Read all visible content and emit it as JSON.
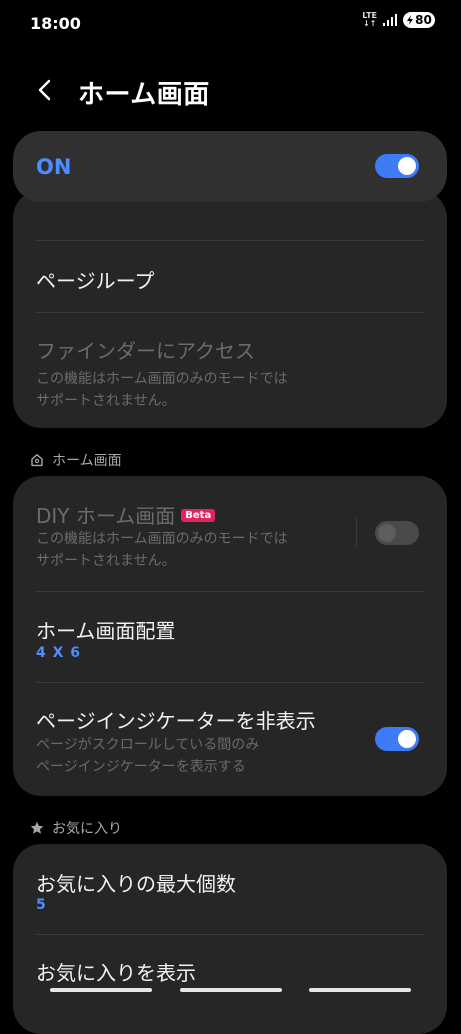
{
  "status": {
    "time": "18:00",
    "network": "LTE",
    "network_arrows": "↓↑",
    "battery": "80"
  },
  "header": {
    "title": "ホーム画面"
  },
  "master": {
    "label": "ON",
    "on": true
  },
  "card1": {
    "items": [
      {
        "title": "ページループ"
      },
      {
        "title": "ファインダーにアクセス",
        "subtitle_lines": [
          "この機能はホーム画面のみのモードでは",
          "サポートされません。"
        ]
      }
    ]
  },
  "section_home": {
    "label": "ホーム画面",
    "icon": "home-outline-icon"
  },
  "card2": {
    "items": [
      {
        "title": "DIY ホーム画面",
        "badge": "Beta",
        "subtitle_lines": [
          "この機能はホーム画面のみのモードでは",
          "サポートされません。"
        ],
        "toggle": false
      },
      {
        "title": "ホーム画面配置",
        "value": "4 X 6"
      },
      {
        "title": "ページインジケーターを非表示",
        "subtitle_lines": [
          "ページがスクロールしている間のみ",
          "ページインジケーターを表示する"
        ],
        "toggle": true
      }
    ]
  },
  "section_fav": {
    "label": "お気に入り",
    "icon": "star-icon"
  },
  "card3": {
    "items": [
      {
        "title": "お気に入りの最大個数",
        "value": "5"
      },
      {
        "title": "お気に入りを表示"
      }
    ]
  },
  "colors": {
    "accent": "#3e7bf6",
    "card": "#262626",
    "badge": "#e0245e"
  }
}
